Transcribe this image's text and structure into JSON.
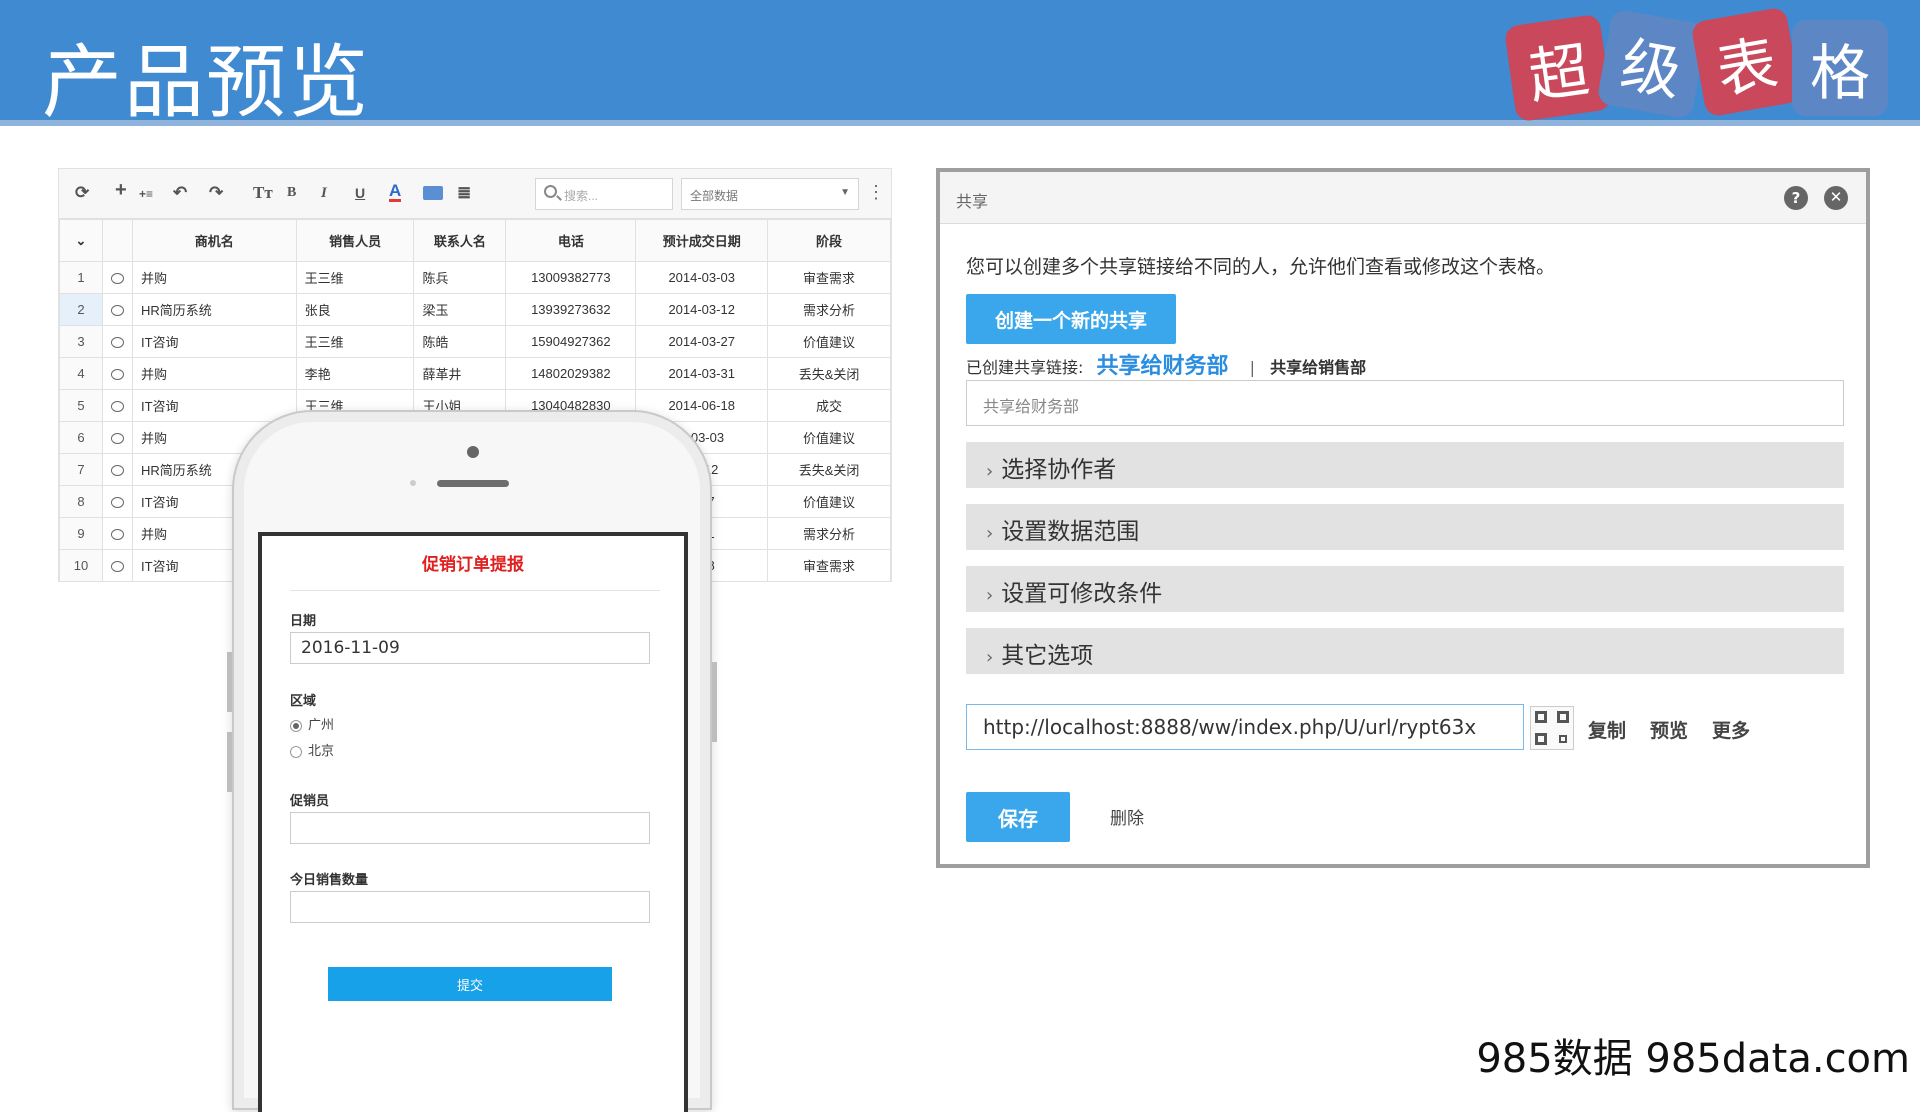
{
  "header": {
    "title": "产品预览",
    "logo_chars": [
      "超",
      "级",
      "表",
      "格"
    ],
    "logo_colors": [
      "#c9485b",
      "#5c87c4",
      "#c9485b",
      "#5c87c4"
    ],
    "banner_color": "#3f8ad0"
  },
  "sheet": {
    "toolbar": {
      "icons": [
        "refresh-icon",
        "add-icon",
        "insert-row-icon",
        "undo-icon",
        "redo-icon",
        "text-size-icon",
        "bold-icon",
        "italic-icon",
        "underline-icon",
        "font-color-icon",
        "fill-color-icon",
        "align-icon"
      ],
      "search_placeholder": "搜索...",
      "filter_value": "全部数据"
    },
    "columns": [
      "商机名",
      "销售人员",
      "联系人名",
      "电话",
      "预计成交日期",
      "阶段"
    ],
    "rows": [
      {
        "n": "1",
        "name": "并购",
        "sales": "王三维",
        "contact": "陈兵",
        "phone": "13009382773",
        "date": "2014-03-03",
        "stage": "审查需求"
      },
      {
        "n": "2",
        "name": "HR简历系统",
        "sales": "张良",
        "contact": "梁玉",
        "phone": "13939273632",
        "date": "2014-03-12",
        "stage": "需求分析"
      },
      {
        "n": "3",
        "name": "IT咨询",
        "sales": "王三维",
        "contact": "陈皓",
        "phone": "15904927362",
        "date": "2014-03-27",
        "stage": "价值建议"
      },
      {
        "n": "4",
        "name": "并购",
        "sales": "李艳",
        "contact": "薛革井",
        "phone": "14802029382",
        "date": "2014-03-31",
        "stage": "丢失&关闭"
      },
      {
        "n": "5",
        "name": "IT咨询",
        "sales": "王三维",
        "contact": "王小姐",
        "phone": "13040482830",
        "date": "2014-06-18",
        "stage": "成交"
      },
      {
        "n": "6",
        "name": "并购",
        "sales": "",
        "contact": "",
        "phone": "",
        "date": "4-03-03",
        "stage": "价值建议"
      },
      {
        "n": "7",
        "name": "HR简历系统",
        "sales": "",
        "contact": "",
        "phone": "",
        "date": "03-12",
        "stage": "丢失&关闭"
      },
      {
        "n": "8",
        "name": "IT咨询",
        "sales": "",
        "contact": "",
        "phone": "",
        "date": "3-27",
        "stage": "价值建议"
      },
      {
        "n": "9",
        "name": "并购",
        "sales": "",
        "contact": "",
        "phone": "",
        "date": "3-31",
        "stage": "需求分析"
      },
      {
        "n": "10",
        "name": "IT咨询",
        "sales": "",
        "contact": "",
        "phone": "",
        "date": "6-18",
        "stage": "审查需求"
      }
    ]
  },
  "mobile_form": {
    "title": "促销订单提报",
    "date_label": "日期",
    "date_value": "2016-11-09",
    "region_label": "区域",
    "region_options": [
      "广州",
      "北京"
    ],
    "region_selected": "广州",
    "promoter_label": "促销员",
    "promoter_value": "",
    "sales_qty_label": "今日销售数量",
    "sales_qty_value": "",
    "submit_label": "提交"
  },
  "share_dialog": {
    "title": "共享",
    "intro": "您可以创建多个共享链接给不同的人，允许他们查看或修改这个表格。",
    "create_button": "创建一个新的共享",
    "created_label": "已创建共享链接:",
    "links": [
      "共享给财务部",
      "共享给销售部"
    ],
    "link_separator": "|",
    "share_name_value": "共享给财务部",
    "sections": [
      "选择协作者",
      "设置数据范围",
      "设置可修改条件",
      "其它选项"
    ],
    "url": "http://localhost:8888/ww/index.php/U/url/rypt63x",
    "actions": [
      "复制",
      "预览",
      "更多"
    ],
    "save_button": "保存",
    "delete_button": "删除"
  },
  "watermark": "985数据 985data.com"
}
